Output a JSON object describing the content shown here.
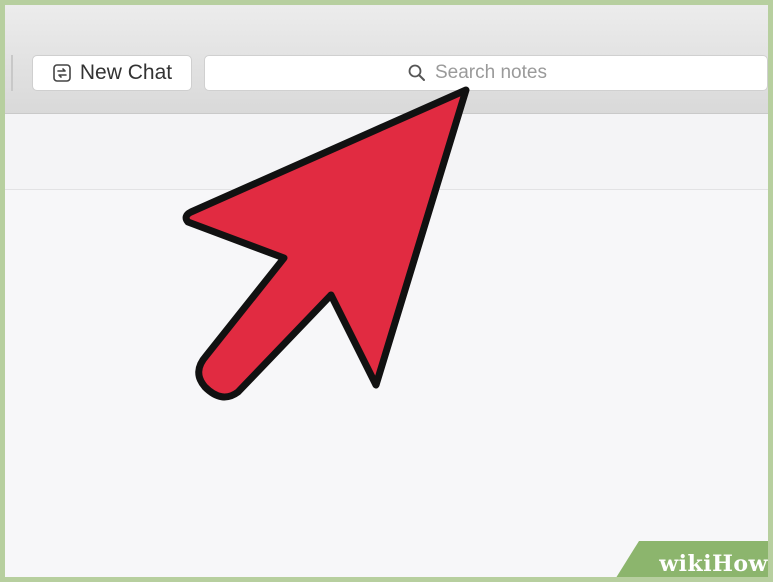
{
  "toolbar": {
    "new_chat_label": "New Chat",
    "new_chat_icon": "new-chat-icon",
    "search_placeholder": "Search notes",
    "search_value": "",
    "search_icon": "magnifier-icon"
  },
  "overlay": {
    "arrow_color": "#e12b41",
    "arrow_outline": "#111111"
  },
  "watermark": {
    "brand": "wikiHow",
    "brand_color": "#8cb56d"
  }
}
